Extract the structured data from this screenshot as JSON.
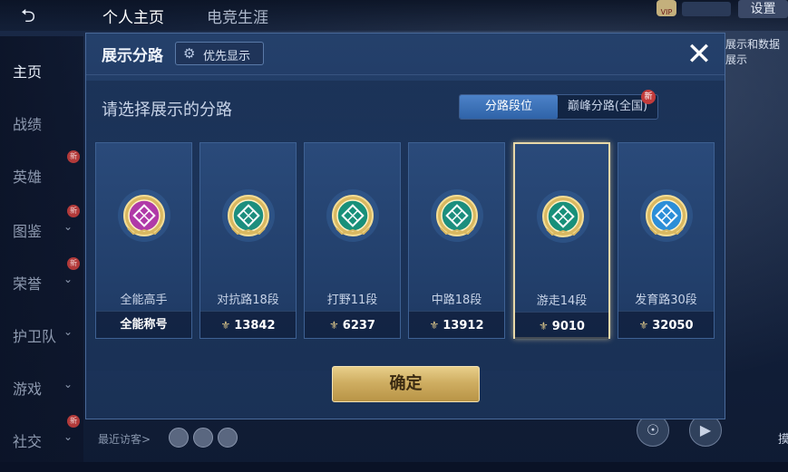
{
  "top_bar": {
    "back_icon": "back-arrow-icon",
    "tabs": [
      "个人主页",
      "电竞生涯"
    ],
    "vip_label": "VIP",
    "settings_label": "设置",
    "right_peek_text": "展示和数据展示"
  },
  "left_nav": {
    "items": [
      {
        "label": "主页",
        "active": true,
        "chevron": false,
        "new_badge": ""
      },
      {
        "label": "战绩",
        "active": false,
        "chevron": false,
        "new_badge": ""
      },
      {
        "label": "英雄",
        "active": false,
        "chevron": false,
        "new_badge": "新"
      },
      {
        "label": "图鉴",
        "active": false,
        "chevron": true,
        "new_badge": "新"
      },
      {
        "label": "荣誉",
        "active": false,
        "chevron": true,
        "new_badge": "新"
      },
      {
        "label": "护卫队",
        "active": false,
        "chevron": true,
        "new_badge": ""
      },
      {
        "label": "游戏",
        "active": false,
        "chevron": true,
        "new_badge": ""
      },
      {
        "label": "社交",
        "active": false,
        "chevron": true,
        "new_badge": "新"
      }
    ]
  },
  "bottom": {
    "visitors_label": "最近访客>",
    "right_edge_text": "摸"
  },
  "modal": {
    "title": "展示分路",
    "priority_button": "优先显示",
    "close_icon": "close-icon",
    "prompt": "请选择展示的分路",
    "toggle": {
      "options": [
        "分路段位",
        "巅峰分路(全国)"
      ],
      "selected": 0,
      "new_badge": "新"
    },
    "cards": [
      {
        "name": "全能高手",
        "footer": "全能称号",
        "has_points": false,
        "emblem_color": "#b03aa8",
        "selected": false
      },
      {
        "name": "对抗路18段",
        "footer": "13842",
        "has_points": true,
        "emblem_color": "#1c8e7e",
        "selected": false
      },
      {
        "name": "打野11段",
        "footer": "6237",
        "has_points": true,
        "emblem_color": "#18907a",
        "selected": false
      },
      {
        "name": "中路18段",
        "footer": "13912",
        "has_points": true,
        "emblem_color": "#1c8e7e",
        "selected": false
      },
      {
        "name": "游走14段",
        "footer": "9010",
        "has_points": true,
        "emblem_color": "#18907a",
        "selected": true
      },
      {
        "name": "发育路30段",
        "footer": "32050",
        "has_points": true,
        "emblem_color": "#2c8ed8",
        "selected": false
      }
    ],
    "confirm_button": "确定"
  },
  "colors": {
    "modal_bg": "#1d365e",
    "accent_blue": "#2f63a8",
    "gold": "#cfae62"
  }
}
